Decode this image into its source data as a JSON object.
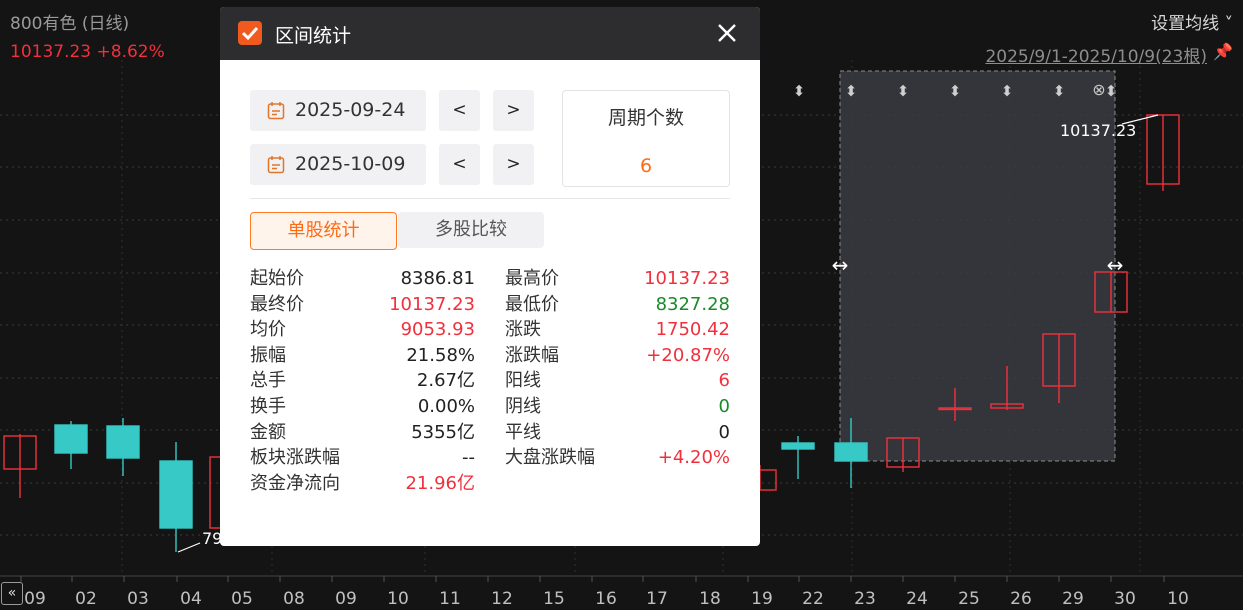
{
  "header": {
    "title": "800有色 (日线)",
    "price_line": "10137.23 +8.62%",
    "ma_setting": "设置均线 ˅",
    "range_label": "2025/9/1-2025/10/9(23根)"
  },
  "chart": {
    "x_labels": [
      "09",
      "02",
      "03",
      "04",
      "05",
      "08",
      "09",
      "10",
      "11",
      "12",
      "15",
      "16",
      "17",
      "18",
      "19",
      "22",
      "23",
      "24",
      "25",
      "26",
      "29",
      "30",
      "10"
    ],
    "high_label": "10137.23",
    "low_label": "79",
    "colors": {
      "up": "#f0313d",
      "down": "#36c9c6",
      "background": "#141414"
    }
  },
  "dialog": {
    "title": "区间统计",
    "start_date": "2025-09-24",
    "end_date": "2025-10-09",
    "prev_label": "<",
    "next_label": ">",
    "period_label": "周期个数",
    "period_value": "6",
    "tab_single": "单股统计",
    "tab_compare": "多股比较",
    "left_stats": [
      {
        "label": "起始价",
        "value": "8386.81",
        "color": "#222222"
      },
      {
        "label": "最终价",
        "value": "10137.23",
        "color": "#f0313d"
      },
      {
        "label": "均价",
        "value": "9053.93",
        "color": "#f0313d"
      },
      {
        "label": "振幅",
        "value": "21.58%",
        "color": "#222222"
      },
      {
        "label": "总手",
        "value": "2.67亿",
        "color": "#222222"
      },
      {
        "label": "换手",
        "value": "0.00%",
        "color": "#222222"
      },
      {
        "label": "金额",
        "value": "5355亿",
        "color": "#222222"
      },
      {
        "label": "板块涨跌幅",
        "value": "--",
        "color": "#222222"
      },
      {
        "label": "资金净流向",
        "value": "21.96亿",
        "color": "#f0313d"
      }
    ],
    "right_stats": [
      {
        "label": "最高价",
        "value": "10137.23",
        "color": "#f0313d"
      },
      {
        "label": "最低价",
        "value": "8327.28",
        "color": "#1b8a2a"
      },
      {
        "label": "涨跌",
        "value": "1750.42",
        "color": "#f0313d"
      },
      {
        "label": "涨跌幅",
        "value": "+20.87%",
        "color": "#f0313d"
      },
      {
        "label": "阳线",
        "value": "6",
        "color": "#f0313d"
      },
      {
        "label": "阴线",
        "value": "0",
        "color": "#1b8a2a"
      },
      {
        "label": "平线",
        "value": "0",
        "color": "#222222"
      },
      {
        "label": "大盘涨跌幅",
        "value": "+4.20%",
        "color": "#f0313d"
      }
    ]
  }
}
